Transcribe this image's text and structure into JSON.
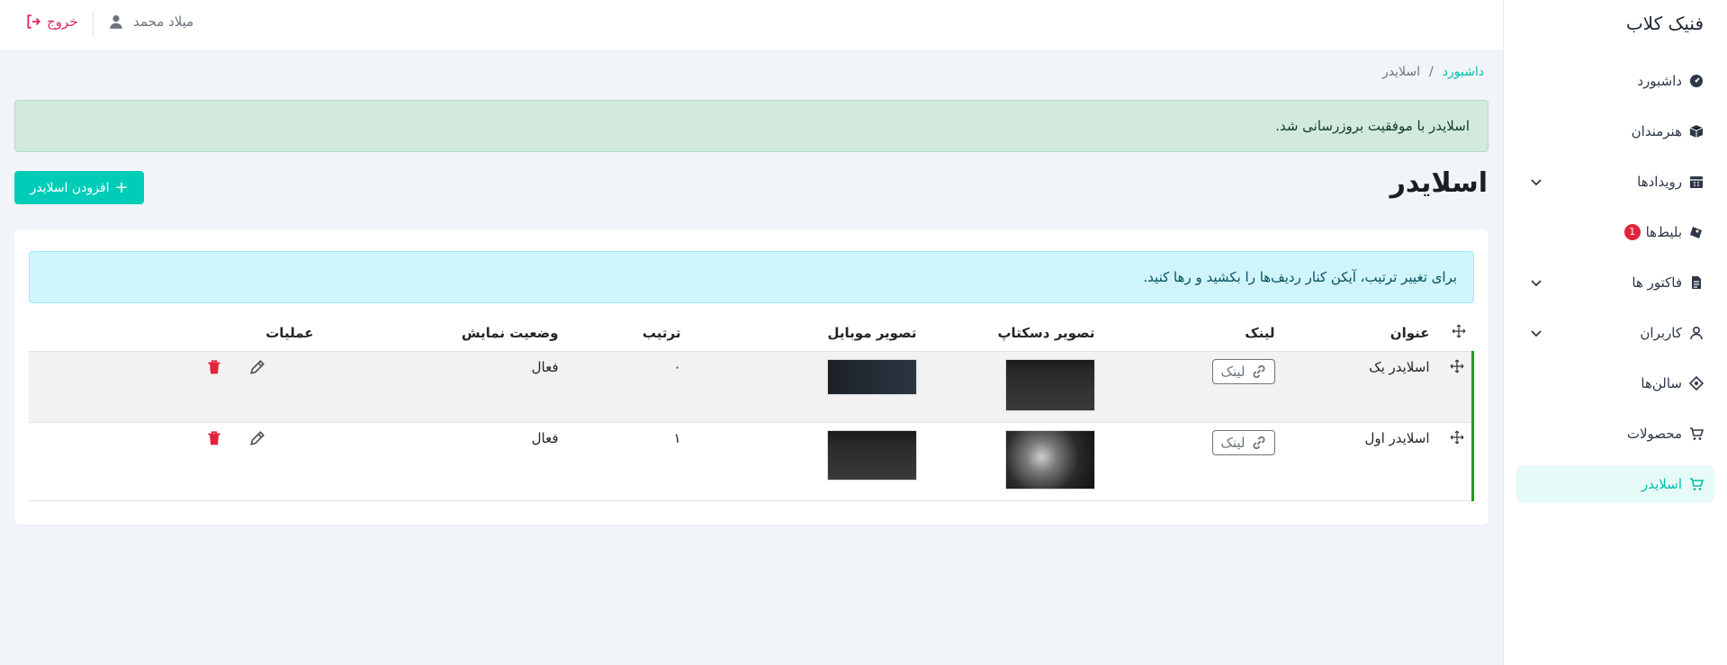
{
  "sidebar": {
    "brand": "فنیک کلاب",
    "items": [
      {
        "label": "داشبورد"
      },
      {
        "label": "هنرمندان"
      },
      {
        "label": "رویدادها"
      },
      {
        "label": "بلیط‌ها",
        "badge": "1"
      },
      {
        "label": "فاکتور ها"
      },
      {
        "label": "کاربران"
      },
      {
        "label": "سالن‌ها"
      },
      {
        "label": "محصولات"
      },
      {
        "label": "اسلایدر"
      }
    ]
  },
  "header": {
    "user_name": "میلاد محمد",
    "logout": "خروج"
  },
  "breadcrumb": {
    "home": "داشبورد",
    "separator": "/",
    "current": "اسلایدر"
  },
  "alerts": {
    "success": "اسلایدر با موفقیت بروزرسانی شد.",
    "info": "برای تغییر ترتیب، آیکن کنار ردیف‌ها را بکشید و رها کنید."
  },
  "page": {
    "title": "اسلایدر",
    "add_button": "افزودن اسلایدر"
  },
  "table": {
    "columns": [
      "عنوان",
      "لینک",
      "تصویر دسکتاپ",
      "تصویر موبایل",
      "ترتیب",
      "وضعیت نمایش",
      "عملیات"
    ],
    "rows": [
      {
        "title": "اسلایدر یک",
        "link_label": "لینک",
        "order": "۰",
        "status": "فعال"
      },
      {
        "title": "اسلایدر اول",
        "link_label": "لینک",
        "order": "۱",
        "status": "فعال"
      }
    ]
  },
  "colors": {
    "accent": "#00cdb8",
    "danger": "#e0243c",
    "success_bg": "#d1eadd",
    "info_bg": "#cff4fc",
    "drag_border": "#18a01e"
  }
}
